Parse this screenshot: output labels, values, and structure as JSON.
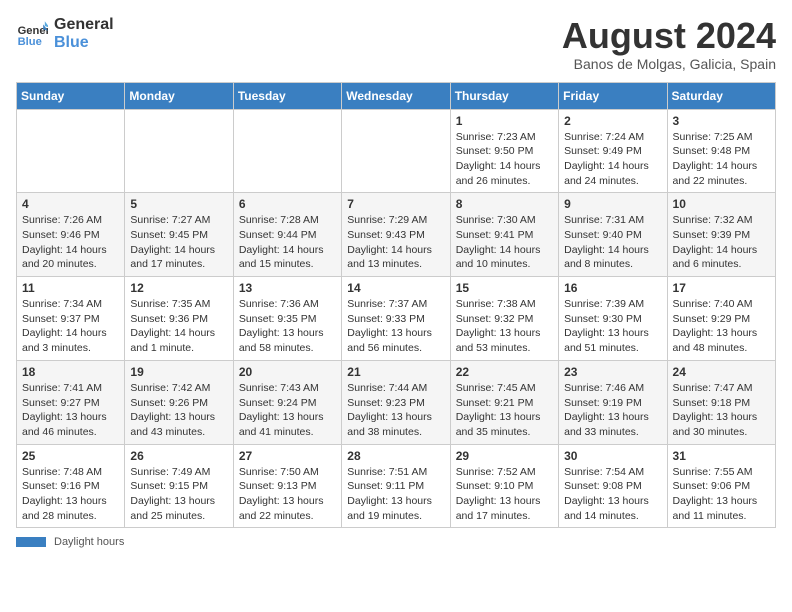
{
  "header": {
    "logo_line1": "General",
    "logo_line2": "Blue",
    "month_title": "August 2024",
    "location": "Banos de Molgas, Galicia, Spain"
  },
  "days_of_week": [
    "Sunday",
    "Monday",
    "Tuesday",
    "Wednesday",
    "Thursday",
    "Friday",
    "Saturday"
  ],
  "weeks": [
    [
      {
        "day": "",
        "info": ""
      },
      {
        "day": "",
        "info": ""
      },
      {
        "day": "",
        "info": ""
      },
      {
        "day": "",
        "info": ""
      },
      {
        "day": "1",
        "info": "Sunrise: 7:23 AM\nSunset: 9:50 PM\nDaylight: 14 hours and 26 minutes."
      },
      {
        "day": "2",
        "info": "Sunrise: 7:24 AM\nSunset: 9:49 PM\nDaylight: 14 hours and 24 minutes."
      },
      {
        "day": "3",
        "info": "Sunrise: 7:25 AM\nSunset: 9:48 PM\nDaylight: 14 hours and 22 minutes."
      }
    ],
    [
      {
        "day": "4",
        "info": "Sunrise: 7:26 AM\nSunset: 9:46 PM\nDaylight: 14 hours and 20 minutes."
      },
      {
        "day": "5",
        "info": "Sunrise: 7:27 AM\nSunset: 9:45 PM\nDaylight: 14 hours and 17 minutes."
      },
      {
        "day": "6",
        "info": "Sunrise: 7:28 AM\nSunset: 9:44 PM\nDaylight: 14 hours and 15 minutes."
      },
      {
        "day": "7",
        "info": "Sunrise: 7:29 AM\nSunset: 9:43 PM\nDaylight: 14 hours and 13 minutes."
      },
      {
        "day": "8",
        "info": "Sunrise: 7:30 AM\nSunset: 9:41 PM\nDaylight: 14 hours and 10 minutes."
      },
      {
        "day": "9",
        "info": "Sunrise: 7:31 AM\nSunset: 9:40 PM\nDaylight: 14 hours and 8 minutes."
      },
      {
        "day": "10",
        "info": "Sunrise: 7:32 AM\nSunset: 9:39 PM\nDaylight: 14 hours and 6 minutes."
      }
    ],
    [
      {
        "day": "11",
        "info": "Sunrise: 7:34 AM\nSunset: 9:37 PM\nDaylight: 14 hours and 3 minutes."
      },
      {
        "day": "12",
        "info": "Sunrise: 7:35 AM\nSunset: 9:36 PM\nDaylight: 14 hours and 1 minute."
      },
      {
        "day": "13",
        "info": "Sunrise: 7:36 AM\nSunset: 9:35 PM\nDaylight: 13 hours and 58 minutes."
      },
      {
        "day": "14",
        "info": "Sunrise: 7:37 AM\nSunset: 9:33 PM\nDaylight: 13 hours and 56 minutes."
      },
      {
        "day": "15",
        "info": "Sunrise: 7:38 AM\nSunset: 9:32 PM\nDaylight: 13 hours and 53 minutes."
      },
      {
        "day": "16",
        "info": "Sunrise: 7:39 AM\nSunset: 9:30 PM\nDaylight: 13 hours and 51 minutes."
      },
      {
        "day": "17",
        "info": "Sunrise: 7:40 AM\nSunset: 9:29 PM\nDaylight: 13 hours and 48 minutes."
      }
    ],
    [
      {
        "day": "18",
        "info": "Sunrise: 7:41 AM\nSunset: 9:27 PM\nDaylight: 13 hours and 46 minutes."
      },
      {
        "day": "19",
        "info": "Sunrise: 7:42 AM\nSunset: 9:26 PM\nDaylight: 13 hours and 43 minutes."
      },
      {
        "day": "20",
        "info": "Sunrise: 7:43 AM\nSunset: 9:24 PM\nDaylight: 13 hours and 41 minutes."
      },
      {
        "day": "21",
        "info": "Sunrise: 7:44 AM\nSunset: 9:23 PM\nDaylight: 13 hours and 38 minutes."
      },
      {
        "day": "22",
        "info": "Sunrise: 7:45 AM\nSunset: 9:21 PM\nDaylight: 13 hours and 35 minutes."
      },
      {
        "day": "23",
        "info": "Sunrise: 7:46 AM\nSunset: 9:19 PM\nDaylight: 13 hours and 33 minutes."
      },
      {
        "day": "24",
        "info": "Sunrise: 7:47 AM\nSunset: 9:18 PM\nDaylight: 13 hours and 30 minutes."
      }
    ],
    [
      {
        "day": "25",
        "info": "Sunrise: 7:48 AM\nSunset: 9:16 PM\nDaylight: 13 hours and 28 minutes."
      },
      {
        "day": "26",
        "info": "Sunrise: 7:49 AM\nSunset: 9:15 PM\nDaylight: 13 hours and 25 minutes."
      },
      {
        "day": "27",
        "info": "Sunrise: 7:50 AM\nSunset: 9:13 PM\nDaylight: 13 hours and 22 minutes."
      },
      {
        "day": "28",
        "info": "Sunrise: 7:51 AM\nSunset: 9:11 PM\nDaylight: 13 hours and 19 minutes."
      },
      {
        "day": "29",
        "info": "Sunrise: 7:52 AM\nSunset: 9:10 PM\nDaylight: 13 hours and 17 minutes."
      },
      {
        "day": "30",
        "info": "Sunrise: 7:54 AM\nSunset: 9:08 PM\nDaylight: 13 hours and 14 minutes."
      },
      {
        "day": "31",
        "info": "Sunrise: 7:55 AM\nSunset: 9:06 PM\nDaylight: 13 hours and 11 minutes."
      }
    ]
  ],
  "footer": {
    "label": "Daylight hours"
  }
}
